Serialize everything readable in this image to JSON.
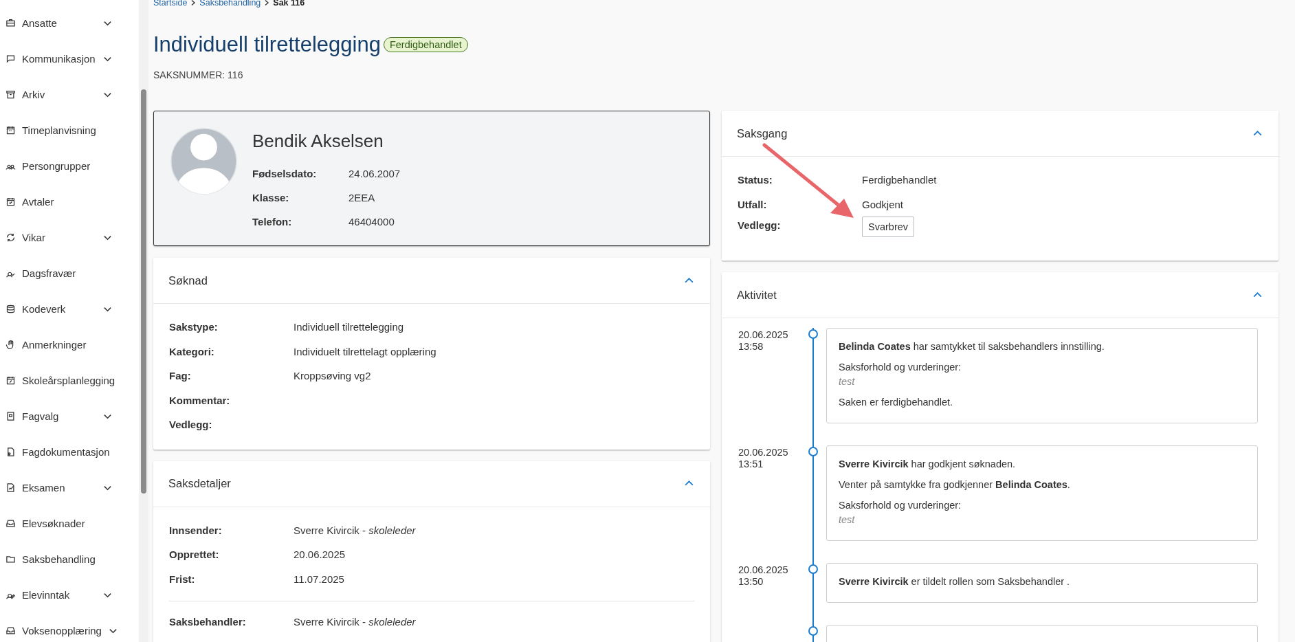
{
  "sidebar": {
    "items": [
      {
        "label": "Ansatte",
        "expandable": true
      },
      {
        "label": "Kommunikasjon",
        "expandable": true
      },
      {
        "label": "Arkiv",
        "expandable": true
      },
      {
        "label": "Timeplanvisning",
        "expandable": false
      },
      {
        "label": "Persongrupper",
        "expandable": false
      },
      {
        "label": "Avtaler",
        "expandable": false
      },
      {
        "label": "Vikar",
        "expandable": true
      },
      {
        "label": "Dagsfravær",
        "expandable": false
      },
      {
        "label": "Kodeverk",
        "expandable": true
      },
      {
        "label": "Anmerkninger",
        "expandable": false
      },
      {
        "label": "Skoleårsplanlegging",
        "expandable": false
      },
      {
        "label": "Fagvalg",
        "expandable": true
      },
      {
        "label": "Fagdokumentasjon",
        "expandable": false
      },
      {
        "label": "Eksamen",
        "expandable": true
      },
      {
        "label": "Elevsøknader",
        "expandable": false
      },
      {
        "label": "Saksbehandling",
        "expandable": false
      },
      {
        "label": "Elevinntak",
        "expandable": true
      },
      {
        "label": "Voksenopplæring",
        "expandable": true
      }
    ]
  },
  "breadcrumb": [
    {
      "label": "Startside",
      "current": false
    },
    {
      "label": "Saksbehandling",
      "current": false
    },
    {
      "label": "Sak 116",
      "current": true
    }
  ],
  "page": {
    "title": "Individuell tilrettelegging",
    "status_badge": "Ferdigbehandlet",
    "case_number": "SAKSNUMMER: 116"
  },
  "person": {
    "name": "Bendik Akselsen",
    "fields": [
      {
        "label": "Fødselsdato:",
        "value": "24.06.2007"
      },
      {
        "label": "Klasse:",
        "value": "2EEA"
      },
      {
        "label": "Telefon:",
        "value": "46404000"
      }
    ]
  },
  "soknad": {
    "title": "Søknad",
    "expanded": true,
    "fields": [
      {
        "label": "Sakstype:",
        "value": "Individuell tilrettelegging"
      },
      {
        "label": "Kategori:",
        "value": "Individuelt tilrettelagt opplæring"
      },
      {
        "label": "Fag:",
        "value": "Kroppsøving vg2"
      },
      {
        "label": "Kommentar:"
      },
      {
        "label": "Vedlegg:"
      }
    ]
  },
  "saksdetaljer": {
    "title": "Saksdetaljer",
    "expanded": true,
    "groups": [
      [
        {
          "label": "Innsender:",
          "value": "Sverre Kivircik - *skoleleder*"
        },
        {
          "label": "Opprettet:",
          "value": "20.06.2025"
        },
        {
          "label": "Frist:",
          "value": "11.07.2025"
        }
      ],
      [
        {
          "label": "Saksbehandler:",
          "value": "Sverre Kivircik - *skoleleder*"
        }
      ]
    ]
  },
  "saksgang": {
    "title": "Saksgang",
    "expanded": true,
    "fields": [
      {
        "label": "Status:",
        "kind": "text",
        "value": "Ferdigbehandlet"
      },
      {
        "label": "Utfall:",
        "kind": "text",
        "value": "Godkjent"
      },
      {
        "label": "Vedlegg:",
        "kind": "button",
        "value": "Svarbrev"
      }
    ]
  },
  "aktivitet": {
    "title": "Aktivitet",
    "expanded": true,
    "entries": [
      {
        "date": "20.06.2025",
        "time": "13:58",
        "blocks": [
          {
            "kind": "text",
            "text": "**Belinda Coates** har samtykket til saksbehandlers innstilling."
          },
          {
            "kind": "note",
            "label": "Saksforhold og vurderinger:",
            "value": "test"
          },
          {
            "kind": "text",
            "text": "Saken er ferdigbehandlet."
          }
        ]
      },
      {
        "date": "20.06.2025",
        "time": "13:51",
        "blocks": [
          {
            "kind": "text",
            "text": "**Sverre Kivircik** har godkjent søknaden."
          },
          {
            "kind": "text",
            "text": "Venter på samtykke fra godkjenner **Belinda Coates**."
          },
          {
            "kind": "note",
            "label": "Saksforhold og vurderinger:",
            "value": "test"
          }
        ]
      },
      {
        "date": "20.06.2025",
        "time": "13:50",
        "blocks": [
          {
            "kind": "text",
            "text": "**Sverre Kivircik** er tildelt rollen som Saksbehandler ."
          }
        ]
      }
    ]
  },
  "annotation": {
    "arrow": true
  }
}
